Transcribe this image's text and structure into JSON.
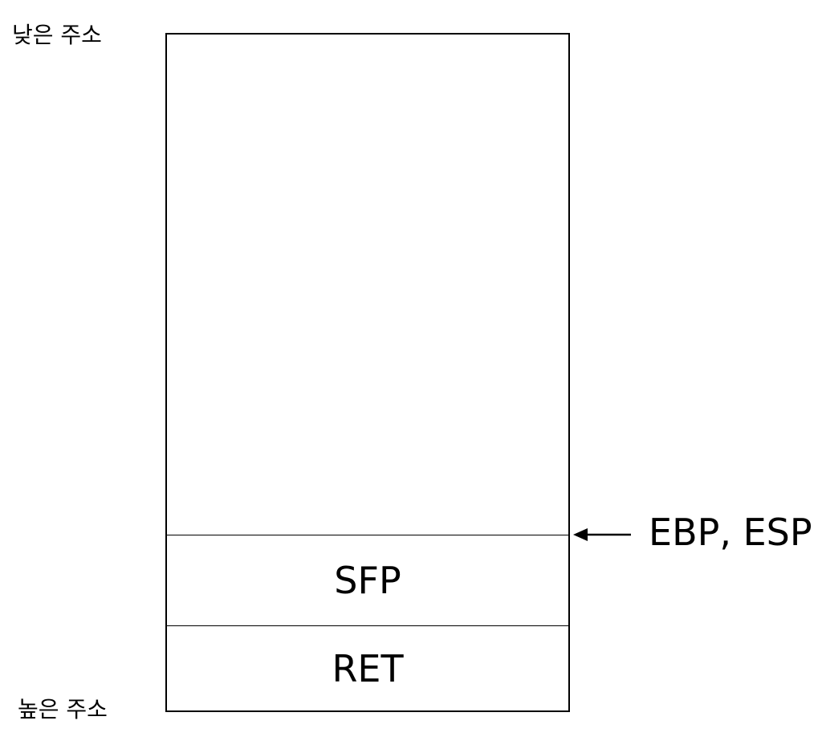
{
  "labels": {
    "low_address": "낮은 주소",
    "high_address": "높은 주소"
  },
  "stack": {
    "cells": [
      "SFP",
      "RET"
    ]
  },
  "pointer": {
    "label": "EBP, ESP"
  }
}
